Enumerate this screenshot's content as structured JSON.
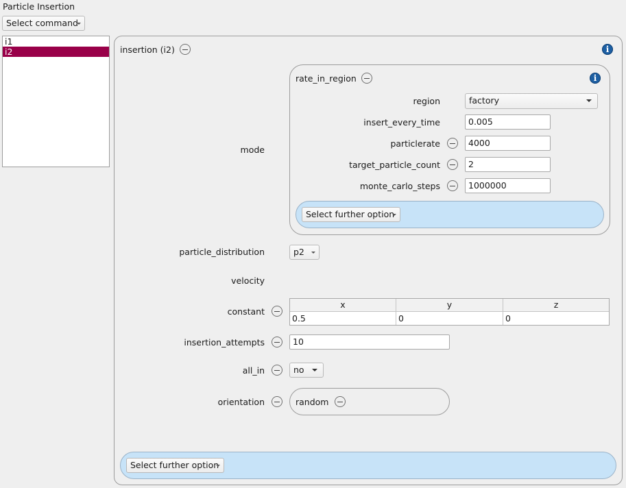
{
  "app": {
    "title": "Particle Insertion"
  },
  "toolbar": {
    "select_command": "Select command"
  },
  "list": {
    "items": [
      "i1",
      "i2"
    ],
    "selected": "i2"
  },
  "colors": {
    "selection": "#990049",
    "option_bar": "#c7e3f8",
    "info": "#1d5fa3"
  },
  "insertion": {
    "title": "insertion (i2)",
    "mode": {
      "label": "mode",
      "title": "rate_in_region",
      "fields": {
        "region": {
          "label": "region",
          "value": "factory"
        },
        "insert_every_time": {
          "label": "insert_every_time",
          "value": "0.005"
        },
        "particlerate": {
          "label": "particlerate",
          "value": "4000"
        },
        "target_particle_count": {
          "label": "target_particle_count",
          "value": "2"
        },
        "monte_carlo_steps": {
          "label": "monte_carlo_steps",
          "value": "1000000"
        }
      },
      "further_option": "Select further option"
    },
    "particle_distribution": {
      "label": "particle_distribution",
      "value": "p2"
    },
    "velocity": {
      "label": "velocity"
    },
    "constant": {
      "label": "constant",
      "headers": [
        "x",
        "y",
        "z"
      ],
      "values": [
        "0.5",
        "0",
        "0"
      ]
    },
    "insertion_attempts": {
      "label": "insertion_attempts",
      "value": "10"
    },
    "all_in": {
      "label": "all_in",
      "value": "no"
    },
    "orientation": {
      "label": "orientation",
      "value": "random"
    },
    "further_option": "Select further option"
  }
}
